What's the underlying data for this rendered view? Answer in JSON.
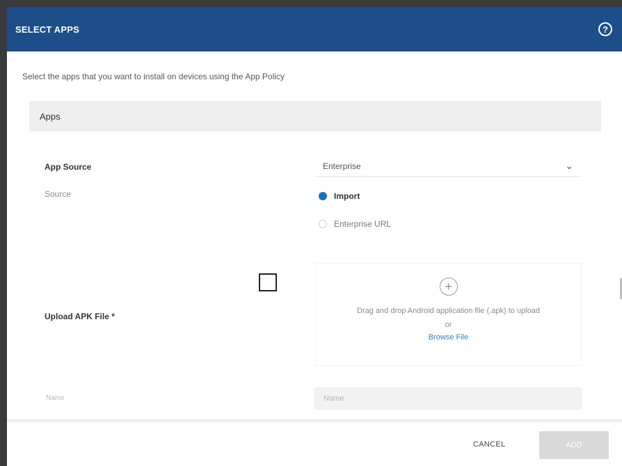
{
  "dialog": {
    "title": "SELECT APPS",
    "help_icon": "?",
    "description": "Select the apps that you want to install on devices using the App Policy"
  },
  "apps": {
    "section_title": "Apps",
    "app_source_label": "App Source",
    "app_source_value": "Enterprise",
    "source_label": "Source",
    "source_options": [
      {
        "label": "Import",
        "selected": true
      },
      {
        "label": "Enterprise URL",
        "selected": false
      }
    ],
    "upload_label": "Upload APK File *",
    "upload": {
      "drop_text": "Drag and drop Android application file (.apk) to upload",
      "or_text": "or",
      "browse_label": "Browse File"
    },
    "name_label": "Name",
    "name_placeholder": "Name"
  },
  "footer": {
    "cancel_label": "CANCEL",
    "add_label": "ADD"
  },
  "colors": {
    "header_bg": "#1d4e89",
    "accent": "#1d6fb8",
    "link": "#2e7fbf"
  }
}
